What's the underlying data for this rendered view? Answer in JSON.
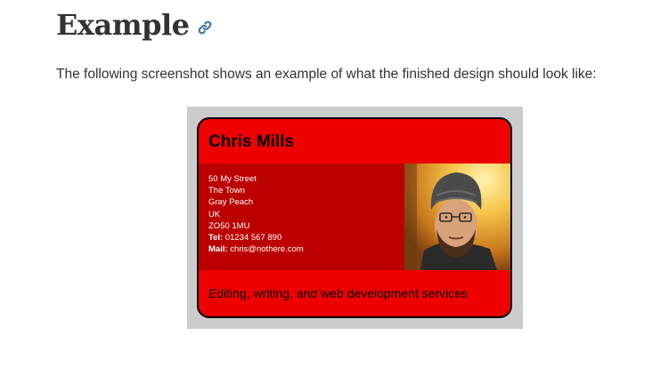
{
  "heading": {
    "title": "Example",
    "link_icon": "link-icon"
  },
  "intro_text": "The following screenshot shows an example of what the finished design should look like:",
  "card": {
    "name": "Chris Mills",
    "address_lines": [
      "50 My Street",
      "The Town",
      "Gray Peach",
      "UK",
      "ZO50 1MU"
    ],
    "tel_label": "Tel:",
    "tel_value": "01234 567 890",
    "mail_label": "Mail:",
    "mail_value": "chris@nothere.com",
    "footer": "Editing, writing, and web development services",
    "colors": {
      "card_red": "#ee0000",
      "body_dark_red": "#bb0000",
      "frame_grey": "#cccccc",
      "link_blue": "#3d7aa8"
    }
  }
}
